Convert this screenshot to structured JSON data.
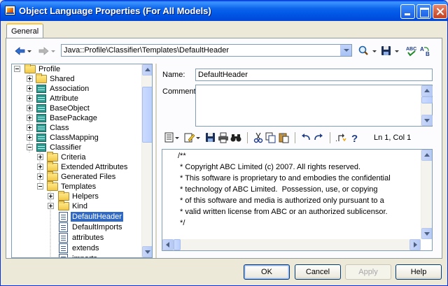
{
  "window": {
    "title": "Object Language Properties (For All Models)"
  },
  "tabs": [
    {
      "label": "General",
      "active": true
    }
  ],
  "toolbar": {
    "path": "Java::Profile\\Classifier\\Templates\\DefaultHeader"
  },
  "tree": {
    "items": [
      {
        "label": "Profile",
        "icon": "folder-icon",
        "expanded": true
      },
      {
        "label": "Shared",
        "icon": "folder-icon",
        "expanded": false
      },
      {
        "label": "Association",
        "icon": "table-icon",
        "expanded": false
      },
      {
        "label": "Attribute",
        "icon": "table-icon",
        "expanded": false
      },
      {
        "label": "BaseObject",
        "icon": "table-icon",
        "expanded": false
      },
      {
        "label": "BasePackage",
        "icon": "table-icon",
        "expanded": false
      },
      {
        "label": "Class",
        "icon": "table-icon",
        "expanded": false
      },
      {
        "label": "ClassMapping",
        "icon": "table-icon",
        "expanded": false
      },
      {
        "label": "Classifier",
        "icon": "table-icon",
        "expanded": true
      },
      {
        "label": "Criteria",
        "icon": "folder-icon",
        "expanded": false
      },
      {
        "label": "Extended Attributes",
        "icon": "folder-icon",
        "expanded": false
      },
      {
        "label": "Generated Files",
        "icon": "folder-icon",
        "expanded": false
      },
      {
        "label": "Templates",
        "icon": "folder-icon",
        "expanded": true
      },
      {
        "label": "Helpers",
        "icon": "folder-icon",
        "expanded": false
      },
      {
        "label": "Kind",
        "icon": "folder-icon",
        "expanded": false
      },
      {
        "label": "DefaultHeader",
        "icon": "template-icon",
        "selected": true
      },
      {
        "label": "DefaultImports",
        "icon": "template-icon"
      },
      {
        "label": "attributes",
        "icon": "template-icon"
      },
      {
        "label": "extends",
        "icon": "template-icon"
      },
      {
        "label": "imports",
        "icon": "template-icon"
      }
    ]
  },
  "form": {
    "name_label": "Name:",
    "name_value": "DefaultHeader",
    "comment_label": "Comment:",
    "comment_value": ""
  },
  "editor": {
    "cursor_position": "Ln 1, Col 1",
    "lines": [
      "/**",
      " * Copyright ABC Limited (c) 2007. All rights reserved.",
      " * This software is proprietary to and embodies the confidential",
      " * technology of ABC Limited.  Possession, use, or copying",
      " * of this software and media is authorized only pursuant to a",
      " * valid written license from ABC or an authorized sublicensor.",
      " */"
    ]
  },
  "buttons": {
    "ok": "OK",
    "cancel": "Cancel",
    "apply": "Apply",
    "help": "Help"
  },
  "colors": {
    "titlebar": "#0055e5",
    "selection": "#316ac5",
    "dialog_bg": "#ece9d8"
  }
}
